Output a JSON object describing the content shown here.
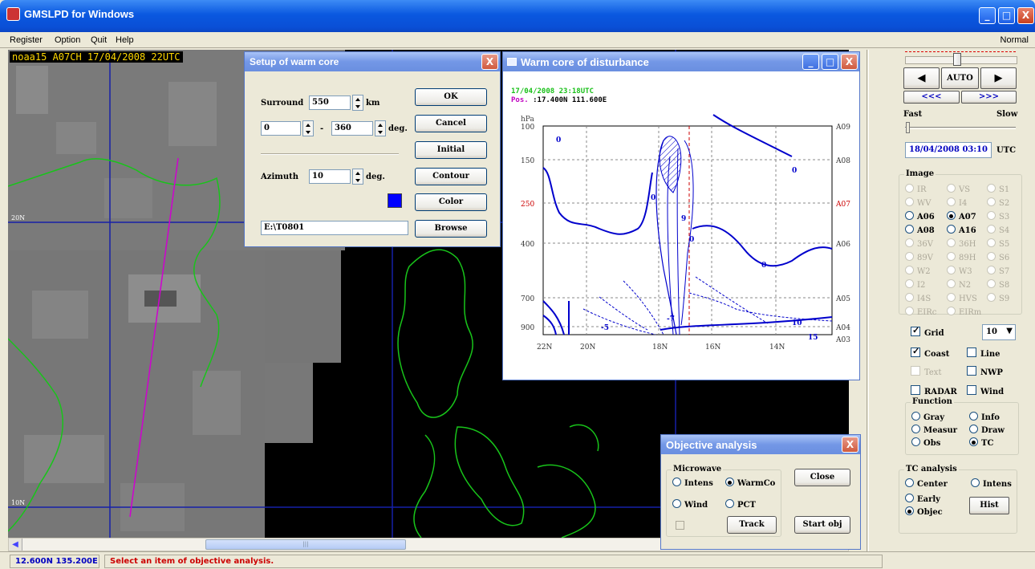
{
  "window": {
    "title": "GMSLPD for Windows",
    "min": "_",
    "max": "□",
    "close": "X"
  },
  "menu": {
    "items": [
      "Register",
      "Option",
      "Quit",
      "Help"
    ],
    "mode": "Normal"
  },
  "map": {
    "label": "noaa15 A07CH 17/04/2008 22UTC",
    "lat20": "20N",
    "lat10": "10N"
  },
  "status": {
    "coords": "12.600N 135.200E",
    "message": "Select an item of objective analysis."
  },
  "setup_dialog": {
    "title": "Setup of warm core",
    "surround_label": "Surround",
    "surround_value": "550",
    "surround_unit": "km",
    "angle_from": "0",
    "angle_sep": "-",
    "angle_to": "360",
    "angle_unit": "deg.",
    "azimuth_label": "Azimuth",
    "azimuth_value": "10",
    "azimuth_unit": "deg.",
    "path": "E:\\T0801",
    "buttons": {
      "ok": "OK",
      "cancel": "Cancel",
      "initial": "Initial",
      "contour": "Contour",
      "color": "Color",
      "browse": "Browse"
    },
    "color_swatch": "#0000ff"
  },
  "warmcore_window": {
    "title": "Warm core of disturbance",
    "datetime": "17/04/2008 23:18UTC",
    "pos_label": "Pos.",
    "pos_value": ":17.400N 111.600E",
    "unit": "hPa",
    "pressure_ticks": [
      "100",
      "150",
      "250",
      "400",
      "700",
      "900"
    ],
    "channel_ticks": [
      "A09",
      "A08",
      "A07",
      "A06",
      "A05",
      "A04",
      "A03"
    ],
    "lat_ticks": [
      "22N",
      "20N",
      "18N",
      "16N",
      "14N"
    ],
    "contour_labels": [
      "0",
      "0",
      "0",
      "0",
      "0",
      "-5",
      "-7",
      "9",
      "10",
      "15"
    ],
    "highlight_color": "#cc0000",
    "contour_color": "#0000cc"
  },
  "objective_dialog": {
    "title": "Objective analysis",
    "group": "Microwave",
    "intens": "Intens",
    "warmco": "WarmCo",
    "wind": "Wind",
    "pct": "PCT",
    "track": "Track",
    "close": "Close",
    "start": "Start obj"
  },
  "right_panel": {
    "auto": "AUTO",
    "prev": "◀",
    "next": "▶",
    "rew": "<<<",
    "ffw": ">>>",
    "fast": "Fast",
    "slow": "Slow",
    "datetime": "18/04/2008 03:10",
    "utc": "UTC",
    "image_group": "Image",
    "image_options": [
      {
        "label": "IR",
        "enabled": false,
        "selected": false
      },
      {
        "label": "VS",
        "enabled": false,
        "selected": false
      },
      {
        "label": "S1",
        "enabled": false,
        "selected": false
      },
      {
        "label": "WV",
        "enabled": false,
        "selected": false
      },
      {
        "label": "I4",
        "enabled": false,
        "selected": false
      },
      {
        "label": "S2",
        "enabled": false,
        "selected": false
      },
      {
        "label": "A06",
        "enabled": true,
        "selected": false
      },
      {
        "label": "A07",
        "enabled": true,
        "selected": true
      },
      {
        "label": "S3",
        "enabled": false,
        "selected": false
      },
      {
        "label": "A08",
        "enabled": true,
        "selected": false
      },
      {
        "label": "A16",
        "enabled": true,
        "selected": false
      },
      {
        "label": "S4",
        "enabled": false,
        "selected": false
      },
      {
        "label": "36V",
        "enabled": false,
        "selected": false
      },
      {
        "label": "36H",
        "enabled": false,
        "selected": false
      },
      {
        "label": "S5",
        "enabled": false,
        "selected": false
      },
      {
        "label": "89V",
        "enabled": false,
        "selected": false
      },
      {
        "label": "89H",
        "enabled": false,
        "selected": false
      },
      {
        "label": "S6",
        "enabled": false,
        "selected": false
      },
      {
        "label": "W2",
        "enabled": false,
        "selected": false
      },
      {
        "label": "W3",
        "enabled": false,
        "selected": false
      },
      {
        "label": "S7",
        "enabled": false,
        "selected": false
      },
      {
        "label": "I2",
        "enabled": false,
        "selected": false
      },
      {
        "label": "N2",
        "enabled": false,
        "selected": false
      },
      {
        "label": "S8",
        "enabled": false,
        "selected": false
      },
      {
        "label": "I4S",
        "enabled": false,
        "selected": false
      },
      {
        "label": "HVS",
        "enabled": false,
        "selected": false
      },
      {
        "label": "S9",
        "enabled": false,
        "selected": false
      },
      {
        "label": "EIRc",
        "enabled": false,
        "selected": false
      },
      {
        "label": "EIRm",
        "enabled": false,
        "selected": false
      }
    ],
    "grid": "Grid",
    "grid_value": "10",
    "coast": "Coast",
    "line": "Line",
    "text": "Text",
    "nwp": "NWP",
    "radar": "RADAR",
    "wind": "Wind",
    "function_group": "Function",
    "functions": [
      {
        "label": "Gray",
        "selected": false
      },
      {
        "label": "Info",
        "selected": false
      },
      {
        "label": "Measur",
        "selected": false
      },
      {
        "label": "Draw",
        "selected": false
      },
      {
        "label": "Obs",
        "selected": false
      },
      {
        "label": "TC",
        "selected": true
      }
    ],
    "tc_group": "TC analysis",
    "center": "Center",
    "intens": "Intens",
    "early": "Early",
    "objec": "Objec",
    "hist": "Hist"
  }
}
